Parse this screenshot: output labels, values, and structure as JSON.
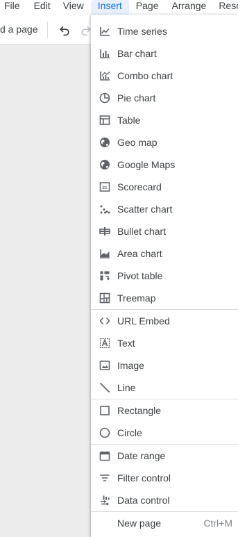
{
  "menubar": {
    "items": [
      "File",
      "Edit",
      "View",
      "Insert",
      "Page",
      "Arrange",
      "Reso"
    ],
    "active": "Insert"
  },
  "toolbar": {
    "add_page_label": "d a page"
  },
  "insert_menu": {
    "groups": [
      [
        {
          "label": "Time series",
          "icon": "time-series-icon"
        },
        {
          "label": "Bar chart",
          "icon": "bar-chart-icon"
        },
        {
          "label": "Combo chart",
          "icon": "combo-chart-icon"
        },
        {
          "label": "Pie chart",
          "icon": "pie-chart-icon"
        },
        {
          "label": "Table",
          "icon": "table-icon"
        },
        {
          "label": "Geo map",
          "icon": "globe-icon"
        },
        {
          "label": "Google Maps",
          "icon": "globe-icon"
        },
        {
          "label": "Scorecard",
          "icon": "scorecard-icon"
        },
        {
          "label": "Scatter chart",
          "icon": "scatter-chart-icon"
        },
        {
          "label": "Bullet chart",
          "icon": "bullet-chart-icon"
        },
        {
          "label": "Area chart",
          "icon": "area-chart-icon"
        },
        {
          "label": "Pivot table",
          "icon": "pivot-table-icon"
        },
        {
          "label": "Treemap",
          "icon": "treemap-icon"
        }
      ],
      [
        {
          "label": "URL Embed",
          "icon": "code-icon"
        },
        {
          "label": "Text",
          "icon": "text-icon"
        },
        {
          "label": "Image",
          "icon": "image-icon"
        },
        {
          "label": "Line",
          "icon": "line-icon"
        }
      ],
      [
        {
          "label": "Rectangle",
          "icon": "rectangle-icon"
        },
        {
          "label": "Circle",
          "icon": "circle-icon"
        }
      ],
      [
        {
          "label": "Date range",
          "icon": "calendar-icon"
        },
        {
          "label": "Filter control",
          "icon": "filter-icon"
        },
        {
          "label": "Data control",
          "icon": "data-control-icon"
        }
      ],
      [
        {
          "label": "New page",
          "icon": "",
          "shortcut": "Ctrl+M"
        }
      ]
    ]
  },
  "colors": {
    "accent": "#1a73e8",
    "active_bg": "#e8f0fe",
    "icon": "#5f6368",
    "canvas": "#ececec"
  }
}
